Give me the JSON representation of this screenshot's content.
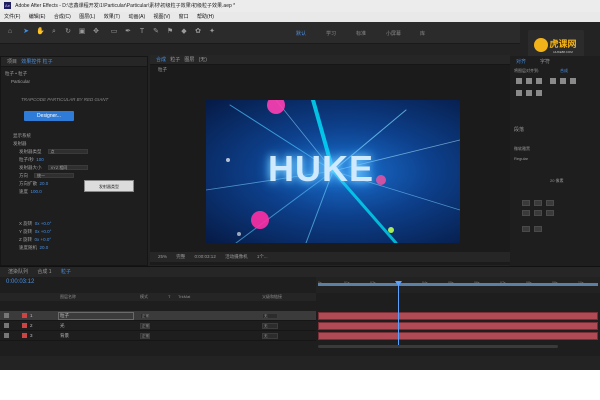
{
  "title_bar": {
    "app_icon": "Ae",
    "text": "Adobe After Effects - D:\\志鑫课程开发\\1\\Particular\\Particular\\素材\\初级粒子效果\\初级粒子效果.aep *"
  },
  "menubar": {
    "items": [
      "文件(F)",
      "编辑(E)",
      "合成(C)",
      "图层(L)",
      "效果(T)",
      "动画(A)",
      "视图(V)",
      "窗口",
      "帮助(H)"
    ]
  },
  "logo": {
    "text": "虎课网",
    "sub": "HUKE88.COM",
    "color": "#f2b21a"
  },
  "toolbar": {
    "tool_icons": [
      "home-icon",
      "select-arrow-icon",
      "hand-icon",
      "zoom-icon",
      "rotate-icon",
      "camera-icon",
      "pan-behind-icon",
      "rectangle-icon",
      "pen-icon",
      "type-icon",
      "brush-icon",
      "clone-icon",
      "eraser-icon",
      "roto-icon",
      "puppet-icon"
    ],
    "workspaces": [
      "默认",
      "学习",
      "标准",
      "小屏幕",
      "库"
    ]
  },
  "effects_panel": {
    "tabs": [
      "项目",
      "效果控件 粒子"
    ],
    "layer_label": "粒子 • 粒子",
    "effect_name": "Particular",
    "plugin_banner": "TRAPCODE PARTICULAR BY RED GIANT",
    "designer_label": "Designer...",
    "rows": [
      {
        "label": "显示系统",
        "value": ""
      },
      {
        "label": "发射器",
        "value": ""
      },
      {
        "label": "发射器类型",
        "value": "点"
      },
      {
        "label": "粒子/秒",
        "value": "100"
      },
      {
        "label": "发射器大小",
        "value": "XYZ 相同"
      },
      {
        "label": "方向",
        "value": "统一"
      },
      {
        "label": "方向扩散",
        "value": "20.0"
      },
      {
        "label": "速度",
        "value": "100.0"
      },
      {
        "label": "X 旋转",
        "value": "0x +0.0°"
      },
      {
        "label": "Y 旋转",
        "value": "0x +0.0°"
      },
      {
        "label": "Z 旋转",
        "value": "0x +0.0°"
      },
      {
        "label": "速度随机",
        "value": "20.0"
      }
    ],
    "tooltip": "发射器类型"
  },
  "composition_panel": {
    "tabs": [
      "合成",
      "粒子",
      "图层",
      "(无)"
    ],
    "breadcrumb": "粒子",
    "headline": "HUKE",
    "bottom_bar": [
      "25%",
      "完整",
      "0:00:03:12",
      "活动摄像机",
      "1个..."
    ]
  },
  "right_panel": {
    "tabs": [
      "对齐",
      "字符"
    ],
    "align_to": "将图层对齐到:",
    "align_target": "合成",
    "section": "段落",
    "font_label": "微软雅黑",
    "font_style": "Regular",
    "size": "20 像素"
  },
  "timeline": {
    "tabs": [
      "渲染队列",
      "合成 1",
      "粒子"
    ],
    "timecode": "0:00:03:12",
    "columns": [
      "图层名称",
      "模式",
      "T",
      "TrkMat",
      "父级和链接"
    ],
    "layers": [
      {
        "num": "1",
        "name": "粒子",
        "mode": "正常",
        "parent": "无"
      },
      {
        "num": "2",
        "name": "光",
        "mode": "正常",
        "parent": "无"
      },
      {
        "num": "3",
        "name": "背景",
        "mode": "正常",
        "parent": "无"
      }
    ],
    "ruler_ticks": [
      "0s",
      "01s",
      "02s",
      "03s",
      "04s",
      "05s",
      "06s",
      "07s",
      "08s",
      "09s",
      "10s"
    ],
    "playhead_time": "0:00:03:12",
    "bar_color": "#b04a55",
    "accent": "#4a90e2"
  }
}
